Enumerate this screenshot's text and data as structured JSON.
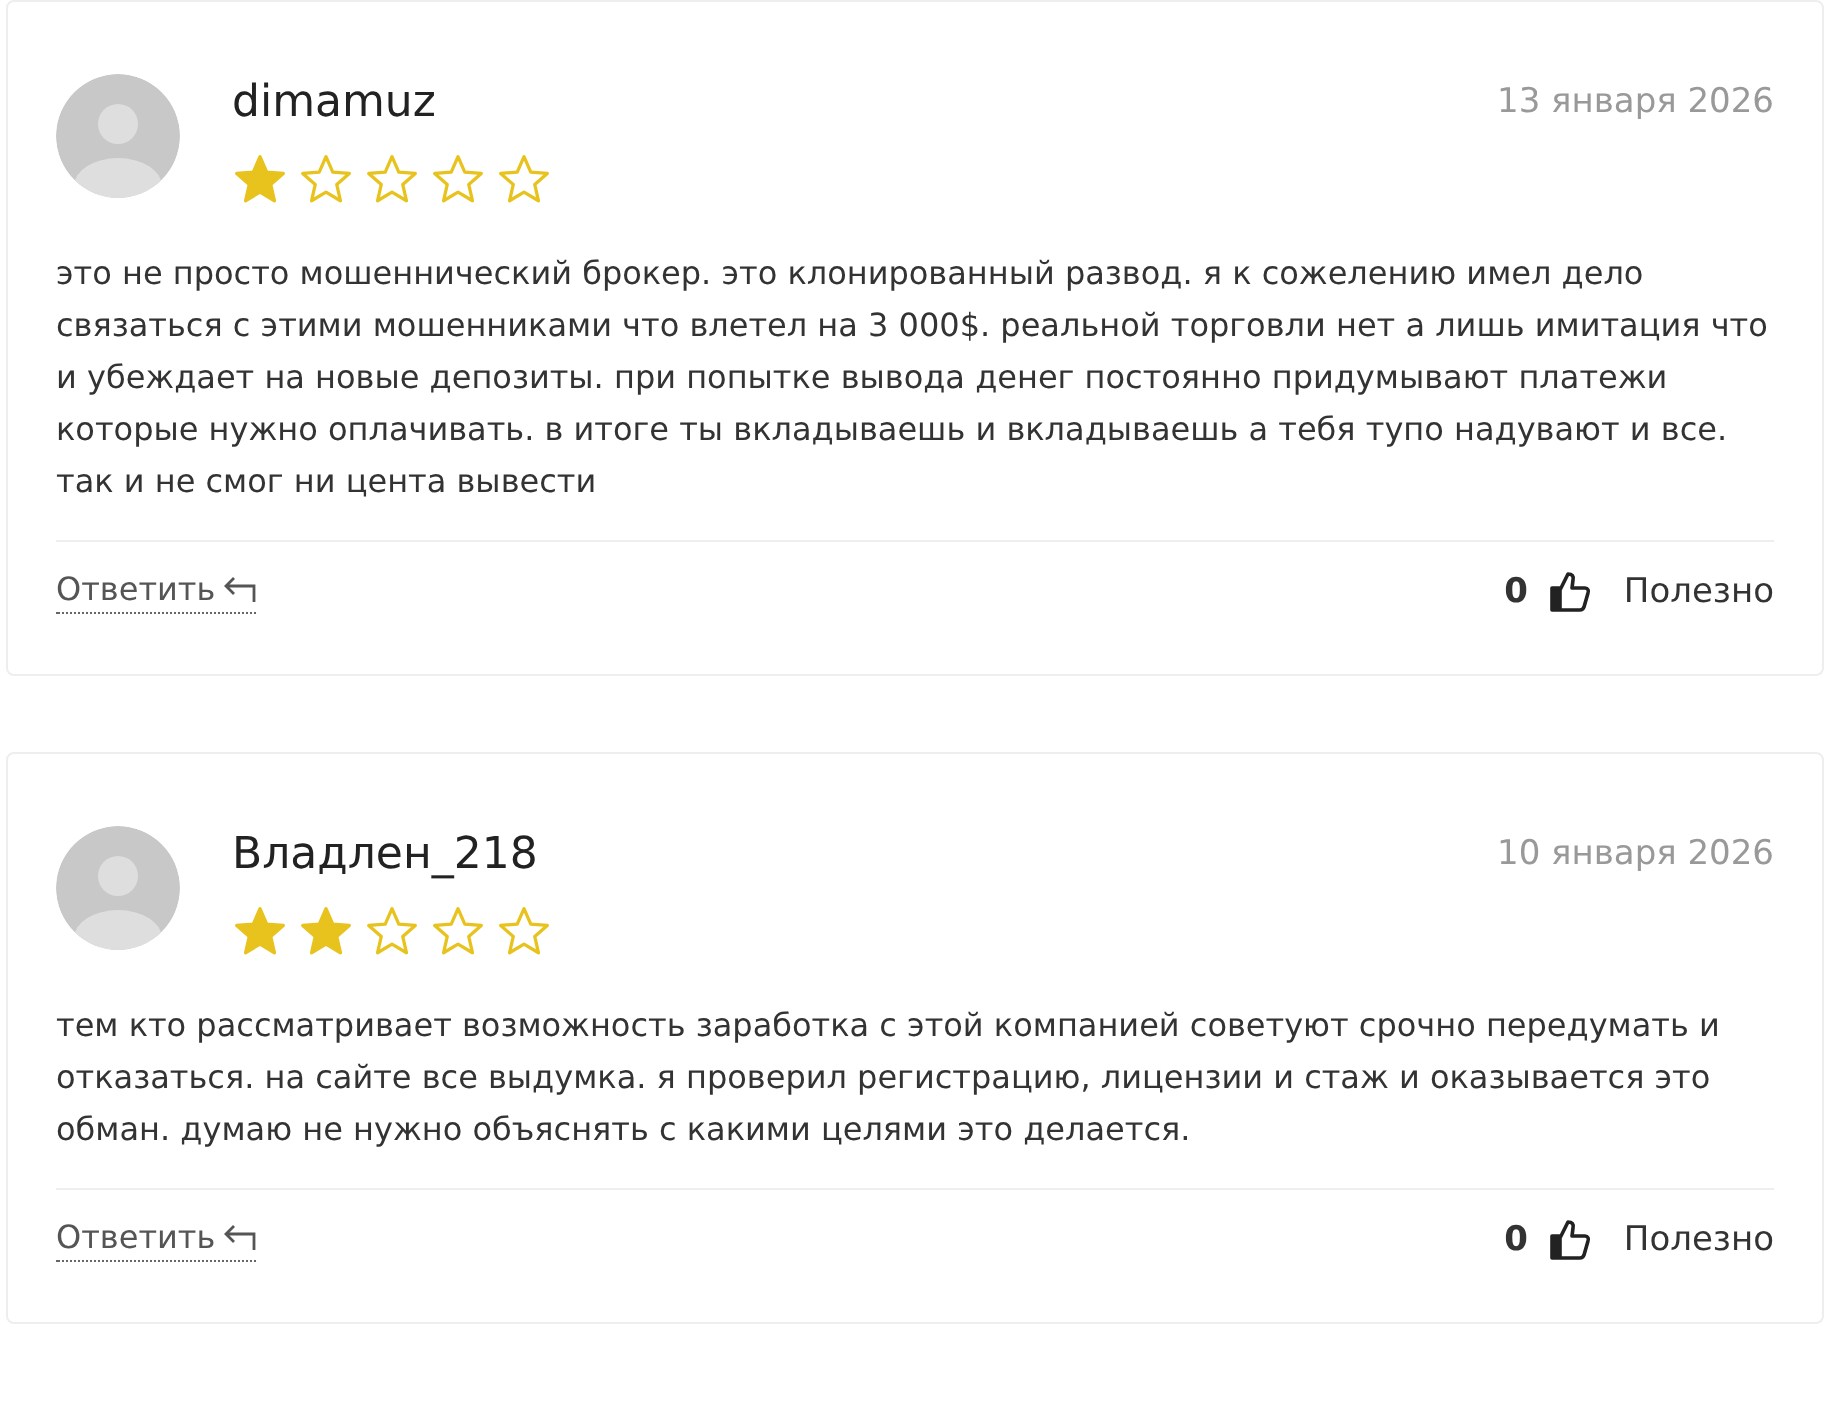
{
  "reviews": [
    {
      "author": "dimamuz",
      "date": "13 января 2026",
      "stars": 1,
      "text": "это не просто мошеннический брокер. это клонированный развод. я к сожелению имел дело связаться с этими мошенниками что влетел на 3 000$. реальной торговли нет а лишь имитация что и убеждает на новые депозиты. при попытке вывода денег постоянно придумывают платежи которые нужно оплачивать. в итоге ты вкладываешь и вкладываешь а тебя тупо надувают и все. так и не смог ни цента вывести",
      "reply": "Ответить",
      "likes": "0",
      "helpful": "Полезно"
    },
    {
      "author": "Владлен_218",
      "date": "10 января 2026",
      "stars": 2,
      "text": "тем кто рассматривает возможность заработка с этой компанией советуют срочно передумать и отказаться. на сайте все выдумка. я проверил регистрацию, лицензии и стаж и оказывается это обман. думаю не нужно объяснять с какими целями это делается.",
      "reply": "Ответить",
      "likes": "0",
      "helpful": "Полезно"
    }
  ]
}
